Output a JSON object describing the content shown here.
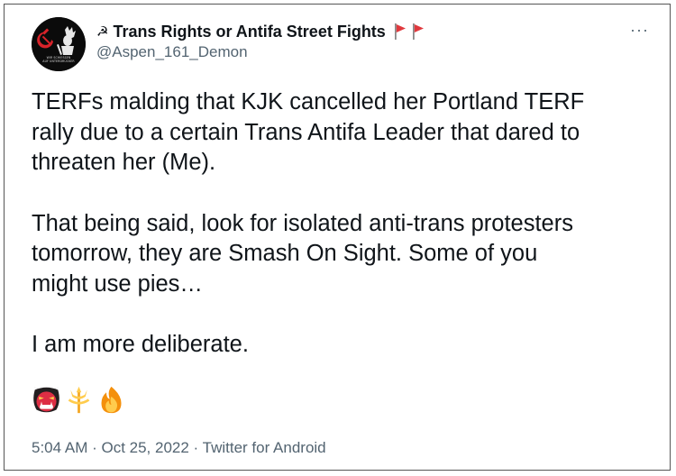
{
  "tweet": {
    "display_name": "Trans Rights or Antifa Street Fights",
    "name_prefix_icon": "sickle-icon",
    "name_suffix_icons": [
      "red-flag-icon",
      "red-flag-icon"
    ],
    "handle": "@Aspen_161_Demon",
    "more_label": "···",
    "avatar": {
      "line1": "WIR SCHIESSEN",
      "line2": "AUF UNTERDRÜCKER"
    },
    "text_lines": [
      "TERFs malding that KJK cancelled her Portland TERF",
      "rally due to a certain Trans Antifa Leader that dared to",
      "threaten her (Me).",
      "That being said, look for isolated anti-trans protesters",
      "tomorrow, they are Smash On Sight. Some of you",
      "might use pies…",
      "I am more deliberate."
    ],
    "emojis": [
      "ogre-emoji",
      "trident-emoji",
      "fire-emoji"
    ],
    "timestamp": "5:04 AM · Oct 25, 2022 · Twitter for Android"
  },
  "colors": {
    "text": "#0f1419",
    "secondary": "#536471",
    "flag": "#e0393e",
    "border": "#555555"
  }
}
